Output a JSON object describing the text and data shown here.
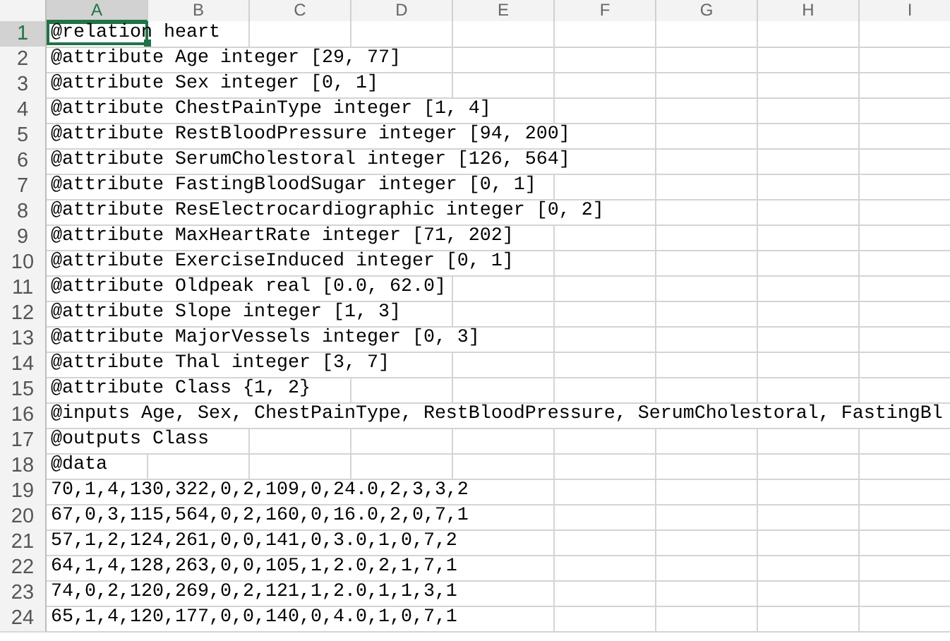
{
  "columns": [
    {
      "label": "A",
      "selected": true
    },
    {
      "label": "B",
      "selected": false
    },
    {
      "label": "C",
      "selected": false
    },
    {
      "label": "D",
      "selected": false
    },
    {
      "label": "E",
      "selected": false
    },
    {
      "label": "F",
      "selected": false
    },
    {
      "label": "G",
      "selected": false
    },
    {
      "label": "H",
      "selected": false
    },
    {
      "label": "I",
      "selected": false
    }
  ],
  "rows": [
    {
      "number": "1",
      "text": "@relation heart",
      "selected": true
    },
    {
      "number": "2",
      "text": "@attribute Age integer [29, 77]",
      "selected": false
    },
    {
      "number": "3",
      "text": "@attribute Sex integer [0, 1]",
      "selected": false
    },
    {
      "number": "4",
      "text": "@attribute ChestPainType integer [1, 4]",
      "selected": false
    },
    {
      "number": "5",
      "text": "@attribute RestBloodPressure integer [94, 200]",
      "selected": false
    },
    {
      "number": "6",
      "text": "@attribute SerumCholestoral integer [126, 564]",
      "selected": false
    },
    {
      "number": "7",
      "text": "@attribute FastingBloodSugar integer [0, 1]",
      "selected": false
    },
    {
      "number": "8",
      "text": "@attribute ResElectrocardiographic integer [0, 2]",
      "selected": false
    },
    {
      "number": "9",
      "text": "@attribute MaxHeartRate integer [71, 202]",
      "selected": false
    },
    {
      "number": "10",
      "text": "@attribute ExerciseInduced integer [0, 1]",
      "selected": false
    },
    {
      "number": "11",
      "text": "@attribute Oldpeak real [0.0, 62.0]",
      "selected": false
    },
    {
      "number": "12",
      "text": "@attribute Slope integer [1, 3]",
      "selected": false
    },
    {
      "number": "13",
      "text": "@attribute MajorVessels integer [0, 3]",
      "selected": false
    },
    {
      "number": "14",
      "text": "@attribute Thal integer [3, 7]",
      "selected": false
    },
    {
      "number": "15",
      "text": "@attribute Class {1, 2}",
      "selected": false
    },
    {
      "number": "16",
      "text": "@inputs Age, Sex, ChestPainType, RestBloodPressure, SerumCholestoral, FastingBl",
      "selected": false
    },
    {
      "number": "17",
      "text": "@outputs Class",
      "selected": false
    },
    {
      "number": "18",
      "text": "@data",
      "selected": false
    },
    {
      "number": "19",
      "text": "70,1,4,130,322,0,2,109,0,24.0,2,3,3,2",
      "selected": false
    },
    {
      "number": "20",
      "text": "67,0,3,115,564,0,2,160,0,16.0,2,0,7,1",
      "selected": false
    },
    {
      "number": "21",
      "text": "57,1,2,124,261,0,0,141,0,3.0,1,0,7,2",
      "selected": false
    },
    {
      "number": "22",
      "text": "64,1,4,128,263,0,0,105,1,2.0,2,1,7,1",
      "selected": false
    },
    {
      "number": "23",
      "text": "74,0,2,120,269,0,2,121,1,2.0,1,1,3,1",
      "selected": false
    },
    {
      "number": "24",
      "text": "65,1,4,120,177,0,0,140,0,4.0,1,0,7,1",
      "selected": false
    }
  ]
}
